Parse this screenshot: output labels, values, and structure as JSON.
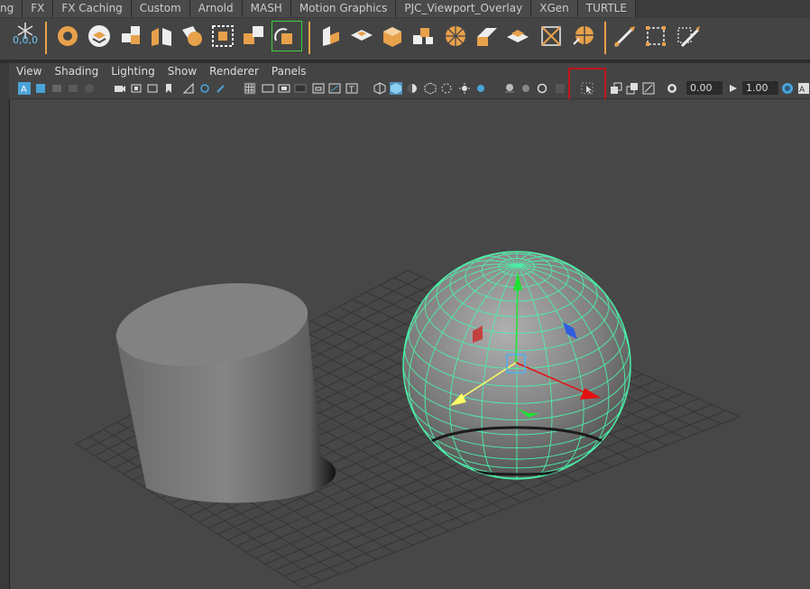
{
  "shelf_tabs": [
    "ng",
    "FX",
    "FX Caching",
    "Custom",
    "Arnold",
    "MASH",
    "Motion Graphics",
    "PJC_Viewport_Overlay",
    "XGen",
    "TURTLE"
  ],
  "shelf": {
    "coord_label": "0,0,0"
  },
  "viewport_menu": [
    "View",
    "Shading",
    "Lighting",
    "Show",
    "Renderer",
    "Panels"
  ],
  "viewport_toolbar": {
    "exposure_value": "0.00",
    "gamma_value": "1.00"
  },
  "colors": {
    "accent": "#e8a14b",
    "wireframe": "#4bf0a8",
    "highlight": "#c0141c",
    "background": "#474747"
  }
}
